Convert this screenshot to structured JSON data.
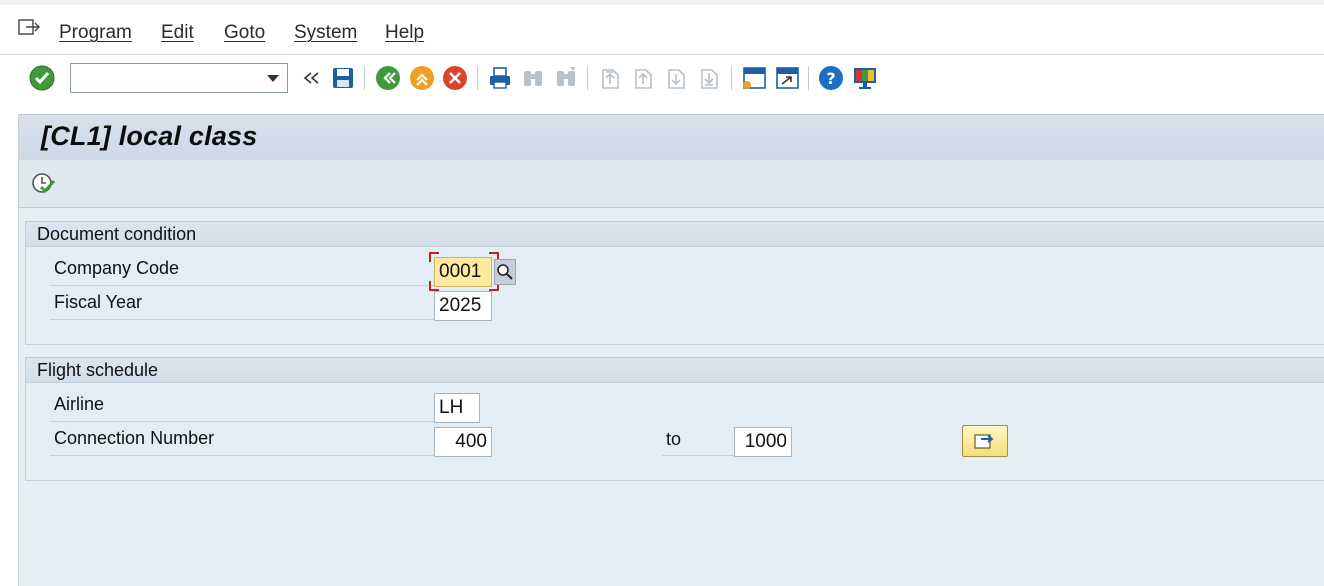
{
  "menu": {
    "items": [
      "Program",
      "Edit",
      "Goto",
      "System",
      "Help"
    ]
  },
  "toolbar": {
    "command_field_value": "",
    "icons": [
      "enter-icon",
      "command-dropdown-icon",
      "collapse-icon",
      "save-icon",
      "back-icon",
      "exit-icon",
      "cancel-icon",
      "print-icon",
      "find-icon",
      "find-next-icon",
      "first-page-icon",
      "previous-page-icon",
      "next-page-icon",
      "last-page-icon",
      "create-session-icon",
      "shortcut-icon",
      "help-icon",
      "customize-layout-icon"
    ]
  },
  "screen": {
    "title": "[CL1] local class",
    "execute_icon": "execute-icon"
  },
  "groups": {
    "document_condition": {
      "title": "Document condition",
      "company_code_label": "Company Code",
      "company_code_value": "0001",
      "fiscal_year_label": "Fiscal Year",
      "fiscal_year_value": "2025"
    },
    "flight_schedule": {
      "title": "Flight schedule",
      "airline_label": "Airline",
      "airline_value": "LH",
      "connection_label": "Connection Number",
      "connection_from": "400",
      "to_label": "to",
      "connection_to": "1000"
    }
  },
  "colors": {
    "accent_green": "#3e9a3a",
    "focus_field": "#ffeaa0",
    "background": "#e7eef5"
  }
}
